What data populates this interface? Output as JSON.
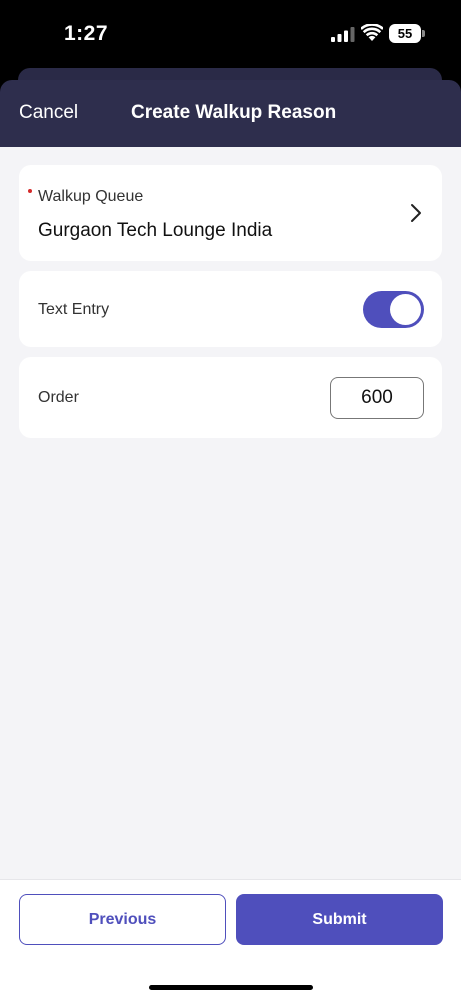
{
  "status_bar": {
    "time": "1:27",
    "battery_level": "55",
    "icons": [
      "signal-icon",
      "wifi-icon",
      "battery-icon"
    ]
  },
  "nav": {
    "cancel_label": "Cancel",
    "title": "Create Walkup Reason"
  },
  "form": {
    "walkup_queue": {
      "label": "Walkup Queue",
      "value": "Gurgaon Tech Lounge India",
      "required": true
    },
    "text_entry": {
      "label": "Text Entry",
      "enabled": true
    },
    "order": {
      "label": "Order",
      "value": "600"
    }
  },
  "footer": {
    "previous_label": "Previous",
    "submit_label": "Submit"
  },
  "colors": {
    "accent": "#4f4fbc",
    "nav_background": "#2e2e4d",
    "required": "#d42a2a",
    "page_background": "#f4f4f7"
  }
}
